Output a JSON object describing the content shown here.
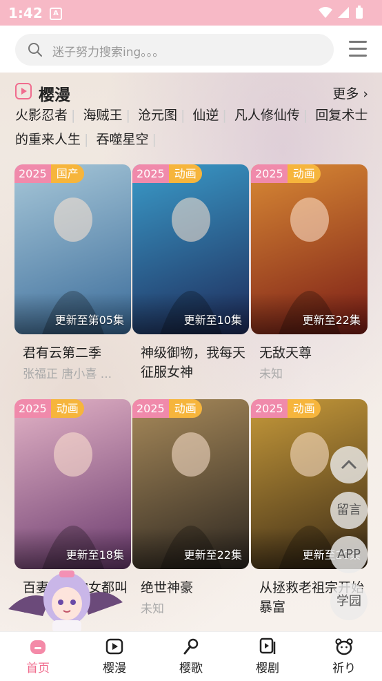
{
  "status_bar": {
    "time": "1:42"
  },
  "search": {
    "placeholder": "迷子努力搜索ing。。。"
  },
  "section": {
    "title": "樱漫",
    "more_label": "更多 ›",
    "tags": [
      "火影忍者",
      "海贼王",
      "沧元图",
      "仙逆",
      "凡人修仙传",
      "回复术士的重来人生",
      "吞噬星空"
    ]
  },
  "cards": [
    {
      "year": "2025",
      "type": "国产",
      "update": "更新至第05集",
      "title": "君有云第二季",
      "subtitle": "张福正 唐小喜 ...",
      "colors": [
        "#3b6c9a",
        "#a7c7d8"
      ]
    },
    {
      "year": "2025",
      "type": "动画",
      "update": "更新至10集",
      "title": "神级御物，我每天征服女神",
      "subtitle": "",
      "colors": [
        "#1e2b5a",
        "#3a9bc9"
      ]
    },
    {
      "year": "2025",
      "type": "动画",
      "update": "更新至22集",
      "title": "无敌天尊",
      "subtitle": "未知",
      "colors": [
        "#7a1c16",
        "#d98a35"
      ]
    },
    {
      "year": "2025",
      "type": "动画",
      "update": "更新至18集",
      "title": "百妻：我的女都叫我",
      "subtitle": "",
      "colors": [
        "#6a3a6e",
        "#e3b3c6"
      ]
    },
    {
      "year": "2025",
      "type": "动画",
      "update": "更新至22集",
      "title": "绝世神豪",
      "subtitle": "未知",
      "colors": [
        "#2c2620",
        "#a88a5a"
      ]
    },
    {
      "year": "2025",
      "type": "动画",
      "update": "更新至20集",
      "title": "从拯救老祖宗开始暴富",
      "subtitle": "",
      "colors": [
        "#3a2a16",
        "#c79a3a"
      ]
    }
  ],
  "floating": {
    "message": "留言",
    "app": "APP",
    "school": "学园"
  },
  "tabs": [
    {
      "label": "首页",
      "icon": "home-icon",
      "active": true
    },
    {
      "label": "樱漫",
      "icon": "play-icon",
      "active": false
    },
    {
      "label": "樱歌",
      "icon": "mic-icon",
      "active": false
    },
    {
      "label": "樱剧",
      "icon": "video-icon",
      "active": false
    },
    {
      "label": "祈り",
      "icon": "bear-icon",
      "active": false
    }
  ]
}
